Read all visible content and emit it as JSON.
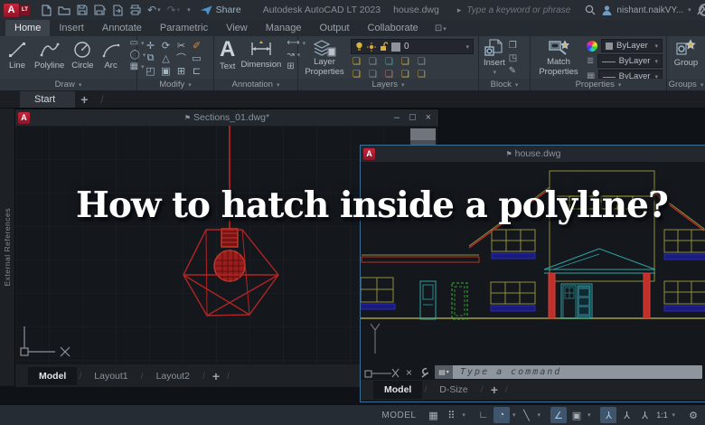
{
  "titlebar": {
    "logo": "A",
    "logo_lt": "LT",
    "share_label": "Share",
    "app_title": "Autodesk AutoCAD LT 2023",
    "doc_name": "house.dwg",
    "search_placeholder": "Type a keyword or phrase",
    "user_name": "nishant.naikVY..."
  },
  "ribbon": {
    "tabs": [
      {
        "label": "Home",
        "active": true
      },
      {
        "label": "Insert",
        "active": false
      },
      {
        "label": "Annotate",
        "active": false
      },
      {
        "label": "Parametric",
        "active": false
      },
      {
        "label": "View",
        "active": false
      },
      {
        "label": "Manage",
        "active": false
      },
      {
        "label": "Output",
        "active": false
      },
      {
        "label": "Collaborate",
        "active": false
      }
    ],
    "draw": {
      "panel_label": "Draw",
      "tools": [
        {
          "label": "Line"
        },
        {
          "label": "Polyline"
        },
        {
          "label": "Circle"
        },
        {
          "label": "Arc"
        }
      ]
    },
    "modify": {
      "panel_label": "Modify"
    },
    "annotation": {
      "panel_label": "Annotation",
      "text_glyph": "A",
      "text_label": "Text",
      "dimension_label": "Dimension"
    },
    "layers": {
      "panel_label": "Layers",
      "button_label": "Layer Properties",
      "current_layer": "0"
    },
    "block": {
      "panel_label": "Block",
      "insert_label": "Insert"
    },
    "properties": {
      "panel_label": "Properties",
      "match_label": "Match Properties",
      "color_value": "ByLayer",
      "lineweight_value": "ByLayer",
      "linetype_value": "ByLayer"
    },
    "groups": {
      "panel_label": "Groups",
      "group_label": "Group"
    }
  },
  "file_tabs": {
    "start_label": "Start"
  },
  "left_palette_label": "External References",
  "overlay_title": "How to hatch inside a polyline?",
  "sections_window": {
    "title": "Sections_01.dwg*",
    "layout_tabs": [
      {
        "label": "Model",
        "active": true
      },
      {
        "label": "Layout1",
        "active": false
      },
      {
        "label": "Layout2",
        "active": false
      }
    ]
  },
  "house_window": {
    "title": "house.dwg",
    "command_placeholder": "Type a command",
    "layout_tabs": [
      {
        "label": "Model",
        "active": true
      },
      {
        "label": "D-Size",
        "active": false
      }
    ]
  },
  "statusbar": {
    "model_label": "MODEL",
    "scale_label": "1:1",
    "icons": [
      {
        "name": "grid-display",
        "glyph": "▦",
        "highlighted": false
      },
      {
        "name": "snap-mode",
        "glyph": "⠿",
        "highlighted": false
      },
      {
        "name": "ortho-mode",
        "glyph": "∟",
        "highlighted": false
      },
      {
        "name": "polar-tracking",
        "glyph": "◔",
        "highlighted": true
      },
      {
        "name": "isometric-drafting",
        "glyph": "╲",
        "highlighted": false
      },
      {
        "name": "object-snap-tracking",
        "glyph": "∠",
        "highlighted": true
      },
      {
        "name": "object-snap",
        "glyph": "▣",
        "highlighted": false
      },
      {
        "name": "annotation-visibility",
        "glyph": "⅄",
        "highlighted": true
      },
      {
        "name": "autoscale",
        "glyph": "⅄",
        "highlighted": false
      },
      {
        "name": "annotation-scale",
        "glyph": "⅄",
        "highlighted": false
      }
    ]
  },
  "icons": {
    "minimize": "–",
    "maximize": "▢",
    "close": "×",
    "caret": "▾",
    "chevron_right": "▸",
    "plus": "+",
    "pin": "⚑",
    "slash": "/",
    "undo": "↶",
    "redo": "↷",
    "ribbon_toggle": "⊡",
    "gear": "⚙",
    "star": "✦",
    "cancel_x": "×",
    "layer_stack": "❏",
    "lineweight_rows": "≣",
    "linetype_grid": "▦",
    "modify_glyphs": [
      "✛",
      "⟳",
      "✂",
      "✐",
      "⧉",
      "△",
      "⌒",
      "▭",
      "◰",
      "▣",
      "⊞",
      "⊏"
    ],
    "draw_mini": [
      "▭",
      "◯",
      "▦"
    ],
    "annotation_mini": [
      "⟷",
      "↝",
      "⊞"
    ],
    "block_mini": [
      "❐",
      "◳",
      "✎"
    ]
  },
  "colors": {
    "cad_red": "#b73128",
    "cad_olive": "#8f8f3c",
    "cad_teal": "#2fa3a3",
    "cad_blue": "#2222a0",
    "cad_green": "#37b037",
    "logo_red": "#c8253c",
    "highlight_blue": "#3f556c",
    "active_window_border": "#3c6d93"
  }
}
